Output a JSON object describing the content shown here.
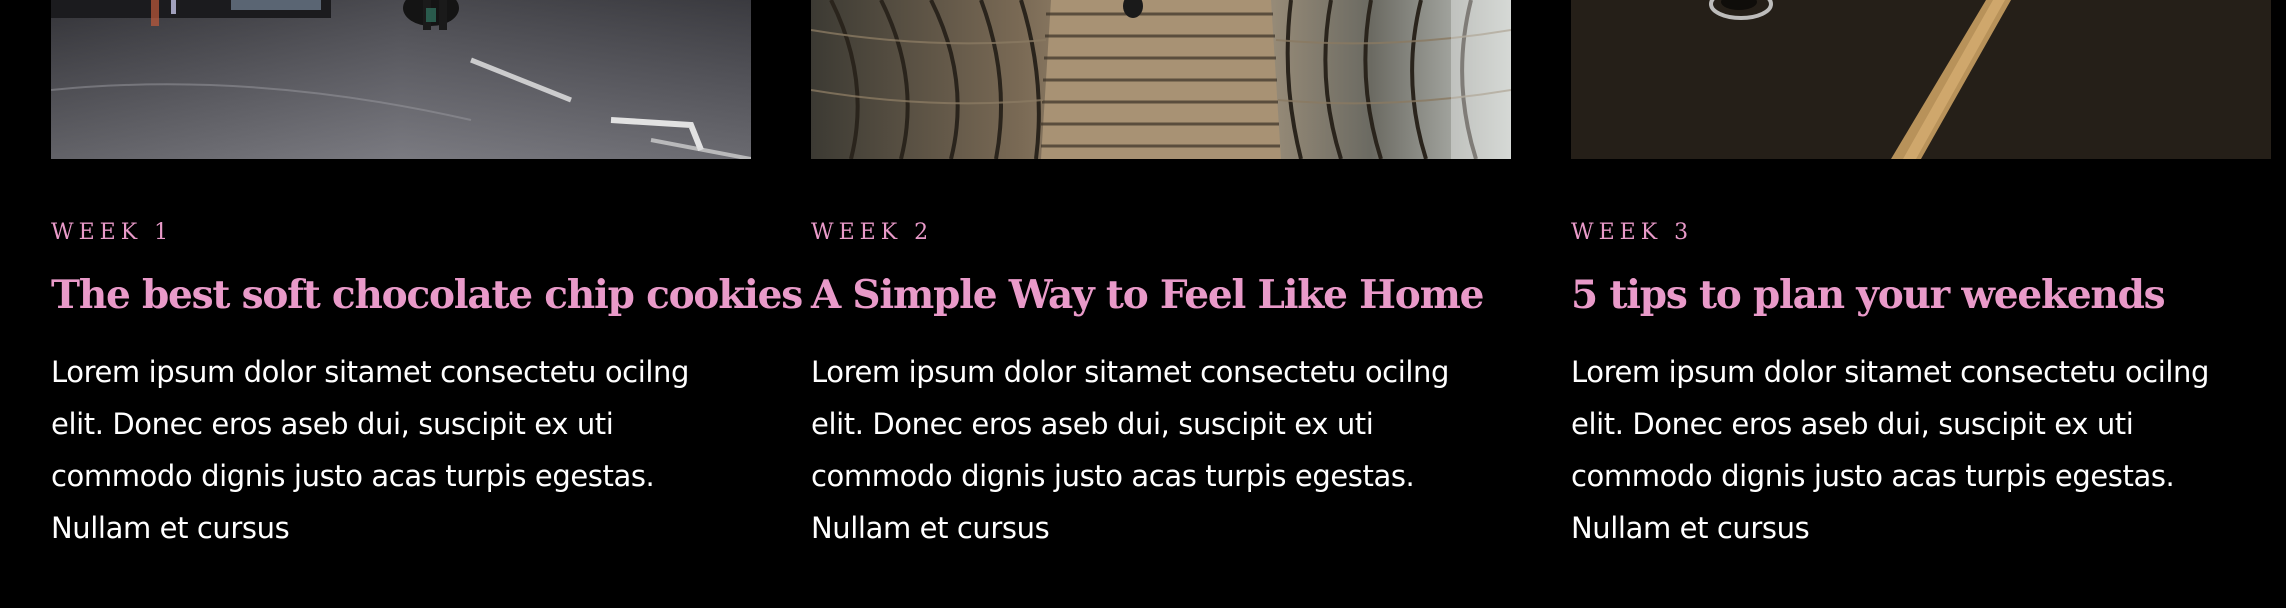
{
  "posts": [
    {
      "week": "WEEK 1",
      "title": "The best soft chocolate chip cookies",
      "excerpt_lines": [
        "Lorem ipsum dolor sitamet consectetu ocilng",
        "elit. Donec eros aseb dui, suscipit ex uti",
        "commodo dignis justo acas turpis egestas.",
        "Nullam et cursus"
      ]
    },
    {
      "week": "WEEK 2",
      "title": "A Simple Way to Feel Like Home",
      "excerpt_lines": [
        "Lorem ipsum dolor sitamet consectetu ocilng",
        "elit. Donec eros aseb dui, suscipit ex uti",
        "commodo dignis justo acas turpis egestas.",
        "Nullam et cursus"
      ]
    },
    {
      "week": "WEEK 3",
      "title": "5 tips to plan your weekends",
      "excerpt_lines": [
        "Lorem ipsum dolor sitamet consectetu ocilng",
        "elit. Donec eros aseb dui, suscipit ex uti",
        "commodo dignis justo acas turpis egestas.",
        "Nullam et cursus"
      ]
    }
  ],
  "colors": {
    "background": "#000000",
    "accent_pink": "#e99ac9",
    "body_text": "#ffffff"
  }
}
